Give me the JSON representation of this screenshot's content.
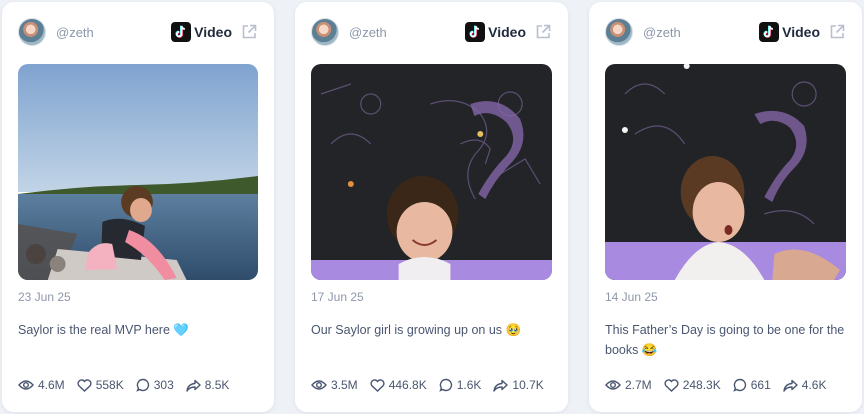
{
  "posts": [
    {
      "handle": "@zeth",
      "platform": "Video",
      "date": "23 Jun 25",
      "caption": "Saylor is the real MVP here 🩵",
      "views": "4.6M",
      "likes": "558K",
      "comments": "303",
      "shares": "8.5K"
    },
    {
      "handle": "@zeth",
      "platform": "Video",
      "date": "17 Jun 25",
      "caption": "Our Saylor girl is growing up on us 🥹",
      "views": "3.5M",
      "likes": "446.8K",
      "comments": "1.6K",
      "shares": "10.7K"
    },
    {
      "handle": "@zeth",
      "platform": "Video",
      "date": "14 Jun 25",
      "caption": "This Father’s Day is going to be one for the books 😂",
      "views": "2.7M",
      "likes": "248.3K",
      "comments": "661",
      "shares": "4.6K"
    }
  ],
  "icons": {
    "platform": "tiktok-icon",
    "external": "external-link-icon",
    "views": "eye-icon",
    "likes": "heart-icon",
    "comments": "comment-icon",
    "shares": "share-icon"
  }
}
